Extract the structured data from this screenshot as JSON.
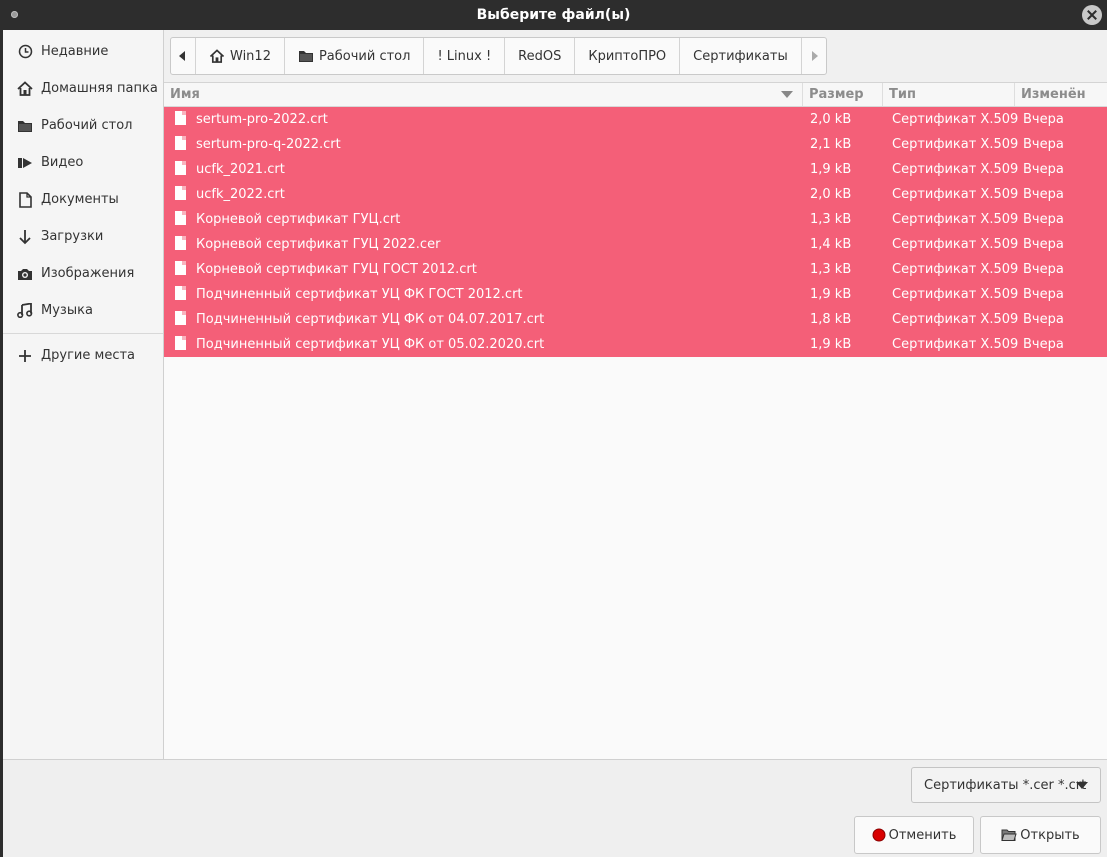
{
  "window": {
    "title": "Выберите файл(ы)"
  },
  "sidebar": {
    "items": [
      {
        "label": "Недавние",
        "icon": "clock-icon"
      },
      {
        "label": "Домашняя папка",
        "icon": "home-icon"
      },
      {
        "label": "Рабочий стол",
        "icon": "folder-icon"
      },
      {
        "label": "Видео",
        "icon": "video-icon"
      },
      {
        "label": "Документы",
        "icon": "document-icon"
      },
      {
        "label": "Загрузки",
        "icon": "download-icon"
      },
      {
        "label": "Изображения",
        "icon": "camera-icon"
      },
      {
        "label": "Музыка",
        "icon": "music-icon"
      }
    ],
    "other_places": {
      "label": "Другие места",
      "icon": "plus-icon"
    }
  },
  "pathbar": {
    "crumbs": [
      "Win12",
      "Рабочий стол",
      "! Linux !",
      "RedOS",
      "КриптоПРО",
      "Сертификаты"
    ]
  },
  "filelist": {
    "columns": {
      "name": "Имя",
      "size": "Размер",
      "type": "Тип",
      "modified": "Изменён"
    },
    "rows": [
      {
        "name": "sertum-pro-2022.crt",
        "size": "2,0 kB",
        "type": "Сертификат X.509",
        "modified": "Вчера"
      },
      {
        "name": "sertum-pro-q-2022.crt",
        "size": "2,1 kB",
        "type": "Сертификат X.509",
        "modified": "Вчера"
      },
      {
        "name": "ucfk_2021.crt",
        "size": "1,9 kB",
        "type": "Сертификат X.509",
        "modified": "Вчера"
      },
      {
        "name": "ucfk_2022.crt",
        "size": "2,0 kB",
        "type": "Сертификат X.509",
        "modified": "Вчера"
      },
      {
        "name": "Корневой сертификат ГУЦ.crt",
        "size": "1,3 kB",
        "type": "Сертификат X.509",
        "modified": "Вчера"
      },
      {
        "name": "Корневой сертификат ГУЦ 2022.cer",
        "size": "1,4 kB",
        "type": "Сертификат X.509",
        "modified": "Вчера"
      },
      {
        "name": "Корневой сертификат ГУЦ ГОСТ 2012.crt",
        "size": "1,3 kB",
        "type": "Сертификат X.509",
        "modified": "Вчера"
      },
      {
        "name": "Подчиненный сертификат УЦ ФК ГОСТ 2012.crt",
        "size": "1,9 kB",
        "type": "Сертификат X.509",
        "modified": "Вчера"
      },
      {
        "name": "Подчиненный сертификат УЦ ФК от 04.07.2017.crt",
        "size": "1,8 kB",
        "type": "Сертификат X.509",
        "modified": "Вчера"
      },
      {
        "name": "Подчиненный сертификат УЦ ФК от 05.02.2020.crt",
        "size": "1,9 kB",
        "type": "Сертификат X.509",
        "modified": "Вчера"
      }
    ]
  },
  "footer": {
    "filter_value": "Сертификаты *.cer *.crt",
    "cancel_label": "Отменить",
    "open_label": "Открыть"
  },
  "colors": {
    "selection": "#f45f78",
    "titlebar": "#2d2d2d"
  }
}
